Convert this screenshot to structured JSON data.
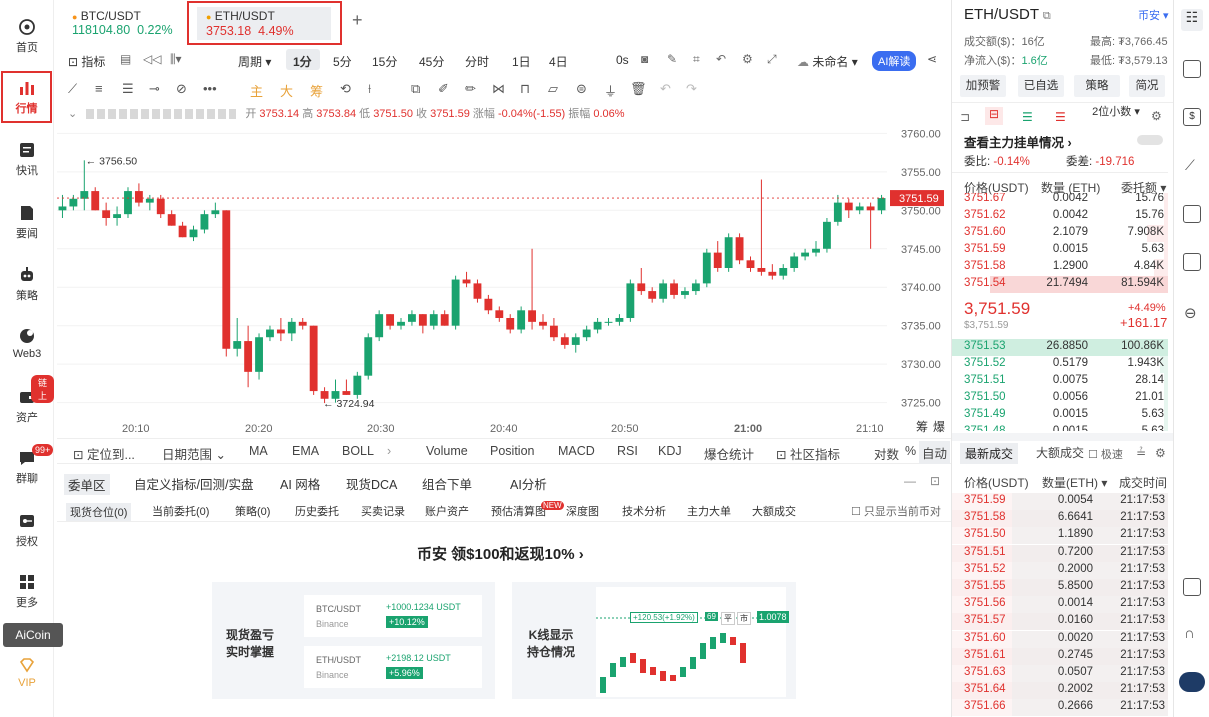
{
  "sidebar": {
    "items": [
      {
        "key": "home",
        "label": "首页",
        "icon": "home-icon"
      },
      {
        "key": "market",
        "label": "行情",
        "icon": "bar-chart-icon",
        "active": true
      },
      {
        "key": "news",
        "label": "快讯",
        "icon": "news-icon"
      },
      {
        "key": "headlines",
        "label": "要闻",
        "icon": "document-icon"
      },
      {
        "key": "strategy",
        "label": "策略",
        "icon": "robot-icon"
      },
      {
        "key": "web3",
        "label": "Web3",
        "icon": "web3-icon"
      },
      {
        "key": "assets",
        "label": "资产",
        "icon": "wallet-icon",
        "badge": "链上"
      },
      {
        "key": "chat",
        "label": "群聊",
        "icon": "chat-icon",
        "badge": "99+"
      },
      {
        "key": "auth",
        "label": "授权",
        "icon": "key-icon"
      },
      {
        "key": "more",
        "label": "更多",
        "icon": "grid-icon"
      }
    ],
    "aicoin": "AiCoin",
    "vip": "VIP"
  },
  "tabs": [
    {
      "pair": "BTC/USDT",
      "price": "118104.80",
      "change": "0.22%"
    },
    {
      "pair": "ETH/USDT",
      "price": "3753.18",
      "change": "4.49%"
    }
  ],
  "toolbar": {
    "indicator": "指标",
    "period": "周期",
    "intervals": [
      "1分",
      "5分",
      "15分",
      "45分",
      "分时",
      "1日",
      "4日"
    ],
    "active_interval": "1分",
    "zero": "0s",
    "unnamed": "未命名",
    "ai": "AI解读"
  },
  "drawtools": {
    "zhu": "主",
    "da": "大",
    "chou": "筹"
  },
  "ohlc": {
    "open_l": "开",
    "open": "3753.14",
    "high_l": "高",
    "high": "3753.84",
    "low_l": "低",
    "low": "3751.50",
    "close_l": "收",
    "close": "3751.59",
    "chg_l": "涨幅",
    "chg": "-0.04%(-1.55)",
    "amp_l": "振幅",
    "amp": "0.06%"
  },
  "chart": {
    "y_ticks": [
      "3760.00",
      "3755.00",
      "3750.00",
      "3745.00",
      "3740.00",
      "3735.00",
      "3730.00",
      "3725.00"
    ],
    "x_ticks": [
      "20:10",
      "20:20",
      "20:30",
      "20:40",
      "20:50",
      "21:00",
      "21:10"
    ],
    "current": "3751.59",
    "hi_label": "← 3756.50",
    "lo_label": "← 3724.94",
    "chou": "筹",
    "bao": "爆"
  },
  "chart_data": {
    "type": "candlestick",
    "ylim": [
      3723,
      3762
    ],
    "current_price": 3751.59,
    "high_marker": 3756.5,
    "low_marker": 3724.94,
    "candles": [
      [
        3750,
        3752,
        3749,
        3750.5
      ],
      [
        3750.5,
        3752,
        3750,
        3751.5
      ],
      [
        3751.5,
        3756.5,
        3750,
        3752.5
      ],
      [
        3752.5,
        3753,
        3750,
        3750
      ],
      [
        3750,
        3751,
        3748,
        3749
      ],
      [
        3749,
        3750.5,
        3748,
        3749.5
      ],
      [
        3749.5,
        3753,
        3749,
        3752.5
      ],
      [
        3752.5,
        3753.5,
        3750.5,
        3751
      ],
      [
        3751,
        3752,
        3750,
        3751.5
      ],
      [
        3751.5,
        3752,
        3749,
        3749.5
      ],
      [
        3749.5,
        3750,
        3748,
        3748
      ],
      [
        3748,
        3748.5,
        3746.5,
        3746.5
      ],
      [
        3746.5,
        3748,
        3746,
        3747.5
      ],
      [
        3747.5,
        3750,
        3747,
        3749.5
      ],
      [
        3749.5,
        3751,
        3749,
        3750
      ],
      [
        3750,
        3750,
        3731,
        3732
      ],
      [
        3732,
        3736,
        3731,
        3733
      ],
      [
        3733,
        3735,
        3727,
        3729
      ],
      [
        3729,
        3734,
        3728,
        3733.5
      ],
      [
        3733.5,
        3735,
        3733,
        3734.5
      ],
      [
        3734.5,
        3736,
        3733,
        3734
      ],
      [
        3734,
        3736,
        3733,
        3735.5
      ],
      [
        3735.5,
        3736,
        3734.5,
        3735
      ],
      [
        3735,
        3735,
        3726,
        3726.5
      ],
      [
        3726.5,
        3727,
        3724.94,
        3725.5
      ],
      [
        3725.5,
        3728,
        3725,
        3726.5
      ],
      [
        3726.5,
        3728,
        3726,
        3726
      ],
      [
        3726,
        3729,
        3725.5,
        3728.5
      ],
      [
        3728.5,
        3734,
        3728,
        3733.5
      ],
      [
        3733.5,
        3737,
        3733,
        3736.5
      ],
      [
        3736.5,
        3736.5,
        3734.5,
        3735
      ],
      [
        3735,
        3736,
        3734.5,
        3735.5
      ],
      [
        3735.5,
        3737,
        3735,
        3736.5
      ],
      [
        3736.5,
        3736.5,
        3734,
        3735
      ],
      [
        3735,
        3737,
        3734.5,
        3736.5
      ],
      [
        3736.5,
        3737,
        3735,
        3735
      ],
      [
        3735,
        3741.5,
        3734.5,
        3741
      ],
      [
        3741,
        3742,
        3740,
        3740.5
      ],
      [
        3740.5,
        3741,
        3738,
        3738.5
      ],
      [
        3738.5,
        3739,
        3736.5,
        3737
      ],
      [
        3737,
        3737.5,
        3735.5,
        3736
      ],
      [
        3736,
        3736.5,
        3734,
        3734.5
      ],
      [
        3734.5,
        3737.5,
        3734,
        3737
      ],
      [
        3737,
        3745,
        3734.5,
        3735.5
      ],
      [
        3735.5,
        3736.5,
        3734.5,
        3735
      ],
      [
        3735,
        3736,
        3733,
        3733.5
      ],
      [
        3733.5,
        3734,
        3732,
        3732.5
      ],
      [
        3732.5,
        3734,
        3731.5,
        3733.5
      ],
      [
        3733.5,
        3735,
        3733,
        3734.5
      ],
      [
        3734.5,
        3736,
        3734,
        3735.5
      ],
      [
        3735.5,
        3736,
        3735,
        3735.5
      ],
      [
        3735.5,
        3736.5,
        3735,
        3736
      ],
      [
        3736,
        3741,
        3735.5,
        3740.5
      ],
      [
        3740.5,
        3742.5,
        3739,
        3739.5
      ],
      [
        3739.5,
        3740,
        3738,
        3738.5
      ],
      [
        3738.5,
        3741,
        3738,
        3740.5
      ],
      [
        3740.5,
        3741,
        3738.5,
        3739
      ],
      [
        3739,
        3740,
        3738.5,
        3739.5
      ],
      [
        3739.5,
        3741,
        3739,
        3740.5
      ],
      [
        3740.5,
        3745,
        3740,
        3744.5
      ],
      [
        3744.5,
        3746,
        3742,
        3742.5
      ],
      [
        3742.5,
        3747,
        3742,
        3746.5
      ],
      [
        3746.5,
        3747,
        3743,
        3743.5
      ],
      [
        3743.5,
        3744,
        3742,
        3742.5
      ],
      [
        3742.5,
        3754,
        3741.5,
        3742
      ],
      [
        3742,
        3743,
        3741,
        3741.5
      ],
      [
        3741.5,
        3743,
        3741,
        3742.5
      ],
      [
        3742.5,
        3744.5,
        3742,
        3744
      ],
      [
        3744,
        3745,
        3743.5,
        3744.5
      ],
      [
        3744.5,
        3746,
        3744,
        3745
      ],
      [
        3745,
        3749,
        3744.5,
        3748.5
      ],
      [
        3748.5,
        3752,
        3748,
        3751
      ],
      [
        3751,
        3751.5,
        3749,
        3750
      ],
      [
        3750,
        3751,
        3749.5,
        3750.5
      ],
      [
        3750.5,
        3751,
        3745,
        3750
      ],
      [
        3750,
        3752,
        3749.5,
        3751.59
      ]
    ]
  },
  "bottom_ind": {
    "locate": "定位到...",
    "range": "日期范围",
    "items": [
      "MA",
      "EMA",
      "BOLL",
      "Volume",
      "Position",
      "MACD",
      "RSI",
      "KDJ",
      "爆仓统计"
    ],
    "community": "社区指标",
    "log": "对数",
    "pct": "%",
    "auto": "自动"
  },
  "orders": {
    "tabs": [
      "委单区",
      "自定义指标/回测/实盘",
      "AI 网格",
      "现货DCA",
      "组合下单",
      "AI分析"
    ],
    "subtabs": [
      "现货仓位(0)",
      "当前委托(0)",
      "策略(0)",
      "历史委托",
      "买卖记录",
      "账户资产",
      "预估清算图",
      "深度图",
      "技术分析",
      "主力大单",
      "大额成交"
    ],
    "new_badge": "NEW",
    "only_current": "只显示当前币对"
  },
  "promo": {
    "title": "币安 领$100和返现10%",
    "card1_title": "现货盈亏\n实时掌握",
    "btc_pair": "BTC/USDT",
    "btc_pnl": "+1000.1234 USDT",
    "btc_ex": "Binance",
    "btc_pct": "+10.12%",
    "eth_pair": "ETH/USDT",
    "eth_pnl": "+2198.12 USDT",
    "eth_ex": "Binance",
    "eth_pct": "+5.96%",
    "card2_title": "K线显示\n持仓情况",
    "k_pnl": "+120.53(+1.92%)",
    "k_qty": "69",
    "k_flat": "平",
    "k_mkt": "市",
    "k_price": "1.0078"
  },
  "right": {
    "pair": "ETH/USDT",
    "exchange": "币安",
    "vol_l": "成交额($)：",
    "vol": "16亿",
    "hi_l": "最高:",
    "hi": "₮3,766.45",
    "in_l": "净流入($)：",
    "in": "1.6亿",
    "lo_l": "最低:",
    "lo": "₮3,579.13",
    "btns": [
      "加预警",
      "已自选",
      "策略",
      "简况"
    ],
    "decimals": "2位小数",
    "big_orders": "查看主力挂单情况 ›",
    "ratio_l": "委比:",
    "ratio": "-0.14%",
    "diff_l": "委差:",
    "diff": "-19.716",
    "col_price": "价格(USDT)",
    "col_qty": "数量 (ETH)",
    "col_total": "委托额",
    "asks": [
      [
        "3751.67",
        "0.0042",
        "15.76"
      ],
      [
        "3751.62",
        "0.0042",
        "15.76"
      ],
      [
        "3751.60",
        "2.1079",
        "7.908K"
      ],
      [
        "3751.59",
        "0.0015",
        "5.63"
      ],
      [
        "3751.58",
        "1.2900",
        "4.84K"
      ],
      [
        "3751.54",
        "21.7494",
        "81.594K"
      ]
    ],
    "last": "3,751.59",
    "last_usd": "$3,751.59",
    "last_pct": "+4.49%",
    "last_chg": "+161.17",
    "bids": [
      [
        "3751.53",
        "26.8850",
        "100.86K"
      ],
      [
        "3751.52",
        "0.5179",
        "1.943K"
      ],
      [
        "3751.51",
        "0.0075",
        "28.14"
      ],
      [
        "3751.50",
        "0.0056",
        "21.01"
      ],
      [
        "3751.49",
        "0.0015",
        "5.63"
      ],
      [
        "3751.48",
        "0.0015",
        "5.63"
      ]
    ],
    "trades_tab": "最新成交",
    "big_trades_tab": "大额成交",
    "fast": "极速",
    "t_price": "价格(USDT)",
    "t_qty": "数量(ETH)",
    "t_time": "成交时间",
    "trades": [
      [
        "3751.59",
        "0.0054",
        "21:17:53"
      ],
      [
        "3751.58",
        "6.6641",
        "21:17:53"
      ],
      [
        "3751.50",
        "1.1890",
        "21:17:53"
      ],
      [
        "3751.51",
        "0.7200",
        "21:17:53"
      ],
      [
        "3751.52",
        "0.2000",
        "21:17:53"
      ],
      [
        "3751.55",
        "5.8500",
        "21:17:53"
      ],
      [
        "3751.56",
        "0.0014",
        "21:17:53"
      ],
      [
        "3751.57",
        "0.0160",
        "21:17:53"
      ],
      [
        "3751.60",
        "0.0020",
        "21:17:53"
      ],
      [
        "3751.61",
        "0.2745",
        "21:17:53"
      ],
      [
        "3751.63",
        "0.0507",
        "21:17:53"
      ],
      [
        "3751.64",
        "0.2002",
        "21:17:53"
      ],
      [
        "3751.66",
        "0.2666",
        "21:17:53"
      ]
    ]
  }
}
